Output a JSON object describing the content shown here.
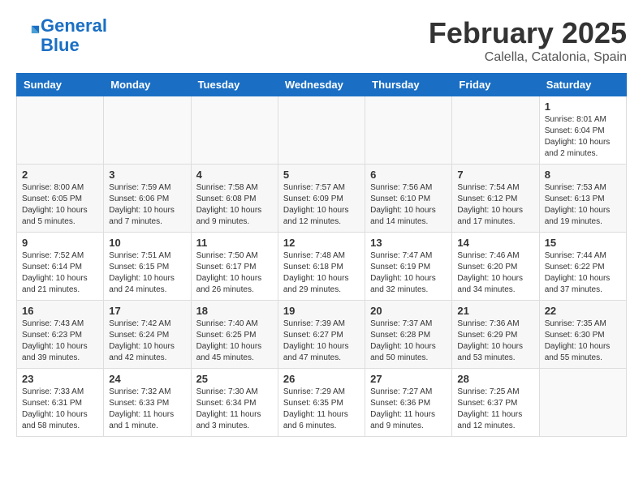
{
  "header": {
    "logo_line1": "General",
    "logo_line2": "Blue",
    "month_title": "February 2025",
    "location": "Calella, Catalonia, Spain"
  },
  "weekdays": [
    "Sunday",
    "Monday",
    "Tuesday",
    "Wednesday",
    "Thursday",
    "Friday",
    "Saturday"
  ],
  "weeks": [
    [
      {
        "day": "",
        "info": ""
      },
      {
        "day": "",
        "info": ""
      },
      {
        "day": "",
        "info": ""
      },
      {
        "day": "",
        "info": ""
      },
      {
        "day": "",
        "info": ""
      },
      {
        "day": "",
        "info": ""
      },
      {
        "day": "1",
        "info": "Sunrise: 8:01 AM\nSunset: 6:04 PM\nDaylight: 10 hours and 2 minutes."
      }
    ],
    [
      {
        "day": "2",
        "info": "Sunrise: 8:00 AM\nSunset: 6:05 PM\nDaylight: 10 hours and 5 minutes."
      },
      {
        "day": "3",
        "info": "Sunrise: 7:59 AM\nSunset: 6:06 PM\nDaylight: 10 hours and 7 minutes."
      },
      {
        "day": "4",
        "info": "Sunrise: 7:58 AM\nSunset: 6:08 PM\nDaylight: 10 hours and 9 minutes."
      },
      {
        "day": "5",
        "info": "Sunrise: 7:57 AM\nSunset: 6:09 PM\nDaylight: 10 hours and 12 minutes."
      },
      {
        "day": "6",
        "info": "Sunrise: 7:56 AM\nSunset: 6:10 PM\nDaylight: 10 hours and 14 minutes."
      },
      {
        "day": "7",
        "info": "Sunrise: 7:54 AM\nSunset: 6:12 PM\nDaylight: 10 hours and 17 minutes."
      },
      {
        "day": "8",
        "info": "Sunrise: 7:53 AM\nSunset: 6:13 PM\nDaylight: 10 hours and 19 minutes."
      }
    ],
    [
      {
        "day": "9",
        "info": "Sunrise: 7:52 AM\nSunset: 6:14 PM\nDaylight: 10 hours and 21 minutes."
      },
      {
        "day": "10",
        "info": "Sunrise: 7:51 AM\nSunset: 6:15 PM\nDaylight: 10 hours and 24 minutes."
      },
      {
        "day": "11",
        "info": "Sunrise: 7:50 AM\nSunset: 6:17 PM\nDaylight: 10 hours and 26 minutes."
      },
      {
        "day": "12",
        "info": "Sunrise: 7:48 AM\nSunset: 6:18 PM\nDaylight: 10 hours and 29 minutes."
      },
      {
        "day": "13",
        "info": "Sunrise: 7:47 AM\nSunset: 6:19 PM\nDaylight: 10 hours and 32 minutes."
      },
      {
        "day": "14",
        "info": "Sunrise: 7:46 AM\nSunset: 6:20 PM\nDaylight: 10 hours and 34 minutes."
      },
      {
        "day": "15",
        "info": "Sunrise: 7:44 AM\nSunset: 6:22 PM\nDaylight: 10 hours and 37 minutes."
      }
    ],
    [
      {
        "day": "16",
        "info": "Sunrise: 7:43 AM\nSunset: 6:23 PM\nDaylight: 10 hours and 39 minutes."
      },
      {
        "day": "17",
        "info": "Sunrise: 7:42 AM\nSunset: 6:24 PM\nDaylight: 10 hours and 42 minutes."
      },
      {
        "day": "18",
        "info": "Sunrise: 7:40 AM\nSunset: 6:25 PM\nDaylight: 10 hours and 45 minutes."
      },
      {
        "day": "19",
        "info": "Sunrise: 7:39 AM\nSunset: 6:27 PM\nDaylight: 10 hours and 47 minutes."
      },
      {
        "day": "20",
        "info": "Sunrise: 7:37 AM\nSunset: 6:28 PM\nDaylight: 10 hours and 50 minutes."
      },
      {
        "day": "21",
        "info": "Sunrise: 7:36 AM\nSunset: 6:29 PM\nDaylight: 10 hours and 53 minutes."
      },
      {
        "day": "22",
        "info": "Sunrise: 7:35 AM\nSunset: 6:30 PM\nDaylight: 10 hours and 55 minutes."
      }
    ],
    [
      {
        "day": "23",
        "info": "Sunrise: 7:33 AM\nSunset: 6:31 PM\nDaylight: 10 hours and 58 minutes."
      },
      {
        "day": "24",
        "info": "Sunrise: 7:32 AM\nSunset: 6:33 PM\nDaylight: 11 hours and 1 minute."
      },
      {
        "day": "25",
        "info": "Sunrise: 7:30 AM\nSunset: 6:34 PM\nDaylight: 11 hours and 3 minutes."
      },
      {
        "day": "26",
        "info": "Sunrise: 7:29 AM\nSunset: 6:35 PM\nDaylight: 11 hours and 6 minutes."
      },
      {
        "day": "27",
        "info": "Sunrise: 7:27 AM\nSunset: 6:36 PM\nDaylight: 11 hours and 9 minutes."
      },
      {
        "day": "28",
        "info": "Sunrise: 7:25 AM\nSunset: 6:37 PM\nDaylight: 11 hours and 12 minutes."
      },
      {
        "day": "",
        "info": ""
      }
    ]
  ]
}
